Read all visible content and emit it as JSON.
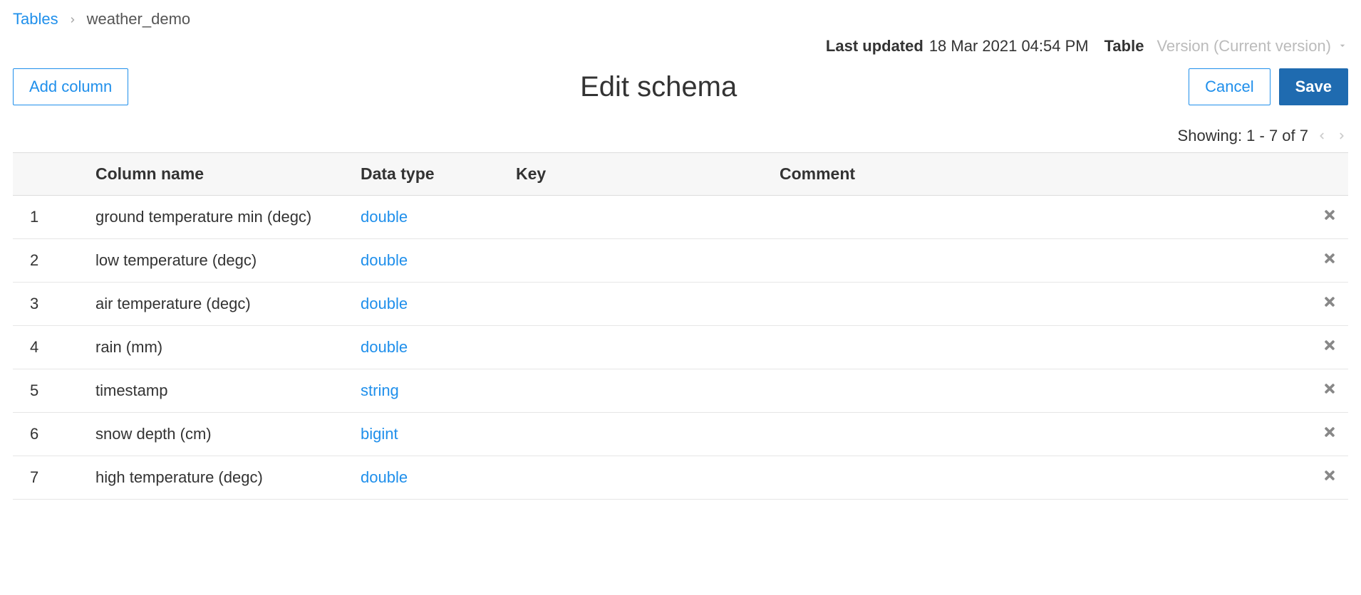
{
  "breadcrumb": {
    "root": "Tables",
    "current": "weather_demo"
  },
  "header": {
    "last_updated_label": "Last updated",
    "last_updated_value": "18 Mar 2021 04:54 PM",
    "table_label": "Table",
    "version_label": "Version (Current version)"
  },
  "toolbar": {
    "add_column": "Add column",
    "title": "Edit schema",
    "cancel": "Cancel",
    "save": "Save"
  },
  "pagination": {
    "text": "Showing: 1 - 7 of 7"
  },
  "table_headers": {
    "idx": "",
    "name": "Column name",
    "type": "Data type",
    "key": "Key",
    "comment": "Comment"
  },
  "rows": [
    {
      "idx": "1",
      "name": "ground temperature min (degc)",
      "type": "double",
      "key": "",
      "comment": ""
    },
    {
      "idx": "2",
      "name": "low temperature (degc)",
      "type": "double",
      "key": "",
      "comment": ""
    },
    {
      "idx": "3",
      "name": "air temperature (degc)",
      "type": "double",
      "key": "",
      "comment": ""
    },
    {
      "idx": "4",
      "name": "rain (mm)",
      "type": "double",
      "key": "",
      "comment": ""
    },
    {
      "idx": "5",
      "name": "timestamp",
      "type": "string",
      "key": "",
      "comment": ""
    },
    {
      "idx": "6",
      "name": "snow depth (cm)",
      "type": "bigint",
      "key": "",
      "comment": ""
    },
    {
      "idx": "7",
      "name": "high temperature (degc)",
      "type": "double",
      "key": "",
      "comment": ""
    }
  ]
}
